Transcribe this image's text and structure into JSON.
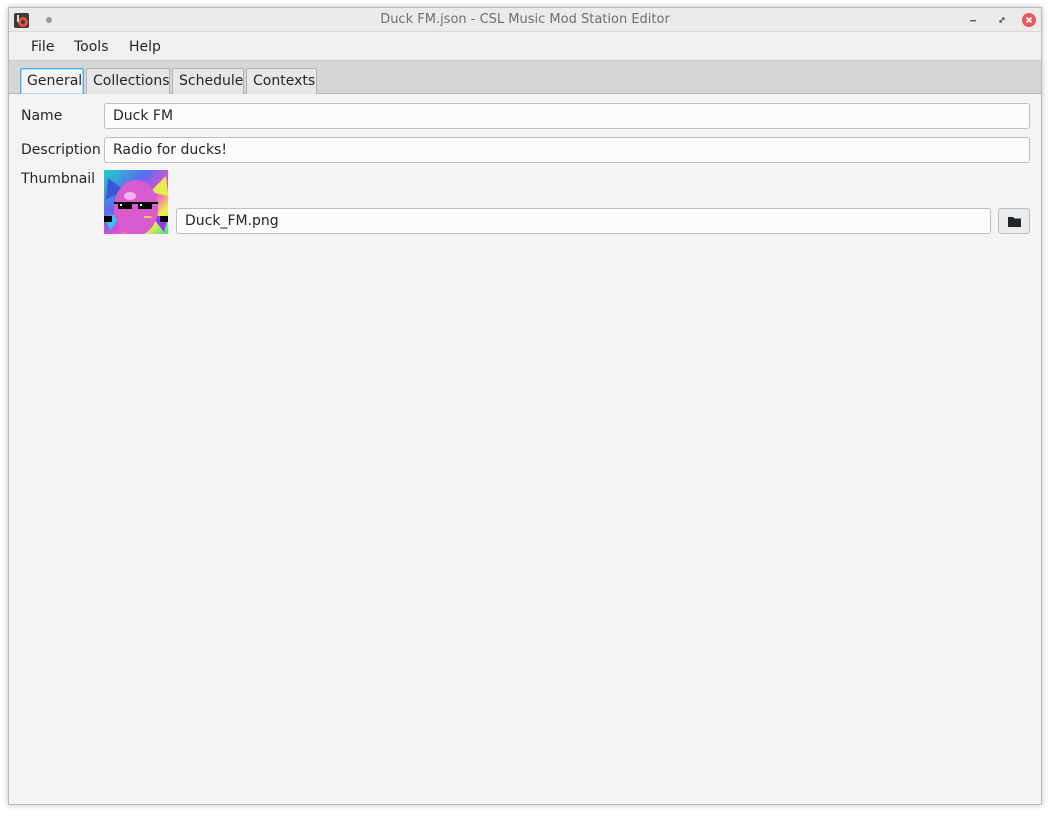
{
  "window": {
    "title": "Duck FM.json - CSL Music Mod Station Editor",
    "close_color": "#e8585b"
  },
  "menu": {
    "file": "File",
    "tools": "Tools",
    "help": "Help"
  },
  "tabs": [
    {
      "label": "General",
      "active": true
    },
    {
      "label": "Collections",
      "active": false
    },
    {
      "label": "Schedule",
      "active": false
    },
    {
      "label": "Contexts",
      "active": false
    }
  ],
  "form": {
    "name_label": "Name",
    "name_value": "Duck FM",
    "description_label": "Description",
    "description_value": "Radio for ducks!",
    "thumbnail_label": "Thumbnail",
    "thumbnail_file": "Duck_FM.png"
  },
  "icons": {
    "app": "app-icon",
    "minimize": "minimize-icon",
    "maximize": "restore-icon",
    "close": "close-icon",
    "browse": "folder-icon"
  },
  "accent": "#3daee9"
}
